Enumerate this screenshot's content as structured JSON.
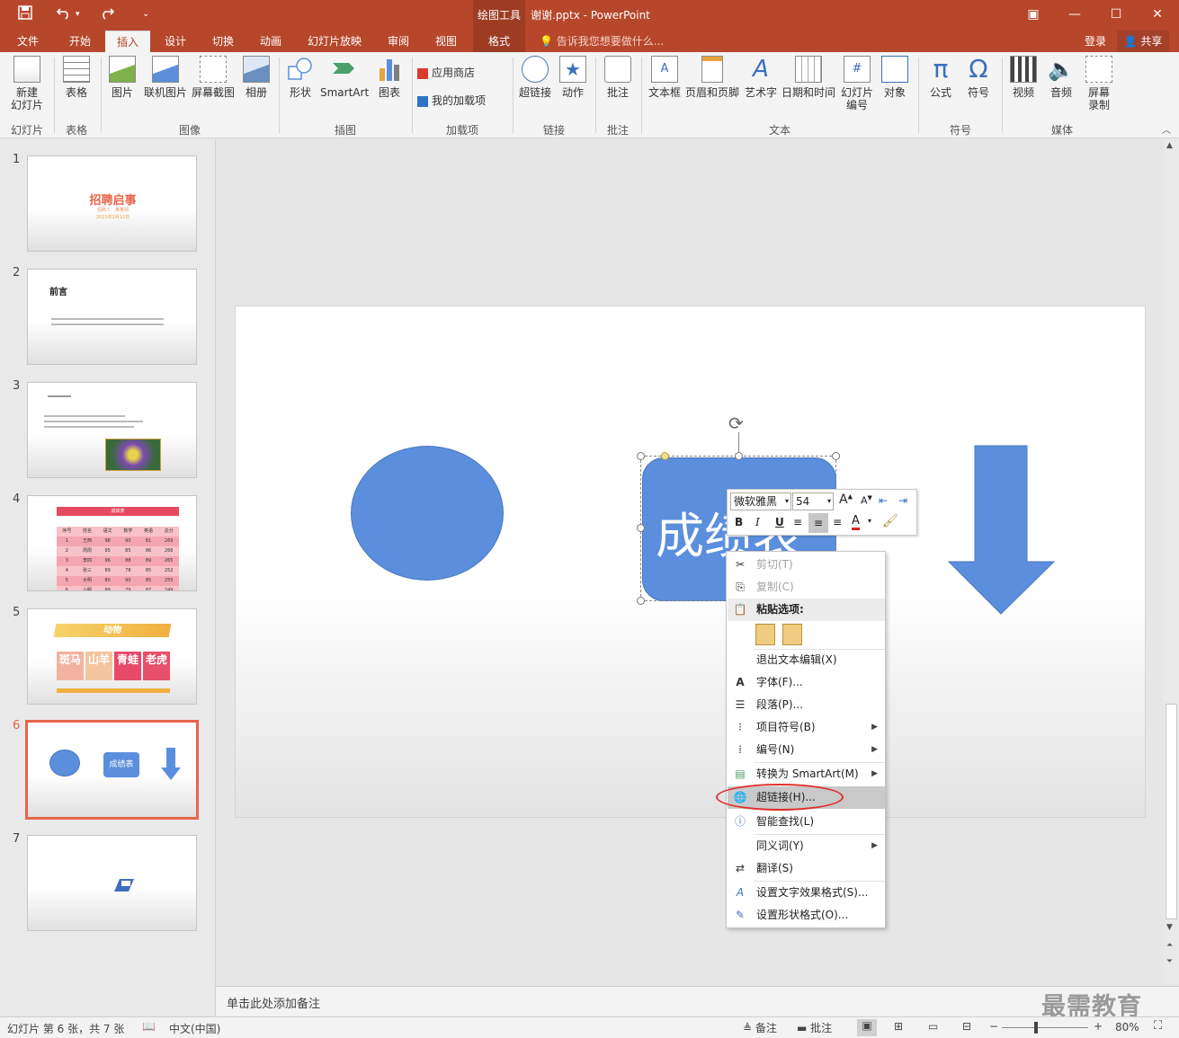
{
  "window": {
    "title": "谢谢.pptx - PowerPoint",
    "context_tab": "绘图工具",
    "controls": {
      "ribbon_display": "▣",
      "minimize": "—",
      "maximize": "☐",
      "close": "✕"
    }
  },
  "qat": {
    "save": "save-icon",
    "undo": "undo-icon",
    "redo": "redo-icon"
  },
  "tabs": [
    "文件",
    "开始",
    "插入",
    "设计",
    "切换",
    "动画",
    "幻灯片放映",
    "审阅",
    "视图",
    "格式"
  ],
  "active_tab": "插入",
  "tellme": "告诉我您想要做什么...",
  "account": {
    "login": "登录",
    "share": "共享"
  },
  "ribbon": {
    "buttons": {
      "new_slide": "新建\n幻灯片",
      "table": "表格",
      "picture": "图片",
      "online_picture": "联机图片",
      "screenshot": "屏幕截图",
      "album": "相册",
      "shapes": "形状",
      "smartart": "SmartArt",
      "chart": "图表",
      "store": "应用商店",
      "my_addins": "我的加载项",
      "hyperlink": "超链接",
      "action": "动作",
      "comment": "批注",
      "textbox": "文本框",
      "header_footer": "页眉和页脚",
      "wordart": "艺术字",
      "datetime": "日期和时间",
      "slide_number": "幻灯片\n编号",
      "object": "对象",
      "equation": "公式",
      "symbol": "符号",
      "video": "视频",
      "audio": "音频",
      "screen_record": "屏幕\n录制"
    },
    "groups": {
      "slides": "幻灯片",
      "tables": "表格",
      "images": "图像",
      "illustrations": "插图",
      "addins": "加载项",
      "links": "链接",
      "comments": "批注",
      "text": "文本",
      "symbols": "符号",
      "media": "媒体"
    }
  },
  "thumbnails": {
    "numbers": [
      "1",
      "2",
      "3",
      "4",
      "5",
      "6",
      "7"
    ],
    "s1_title": "招聘启事",
    "s1_sub": "招聘人：某某网",
    "s1_date": "2021年1月12日",
    "s2_title": "前言",
    "s4_title": "成绩表",
    "s4_headers": [
      "序号",
      "姓名",
      "语文",
      "数学",
      "英语",
      "总分"
    ],
    "s4_rows": [
      [
        "1",
        "王西",
        "98",
        "90",
        "81",
        "269"
      ],
      [
        "2",
        "周周",
        "95",
        "85",
        "86",
        "266"
      ],
      [
        "3",
        "李四",
        "96",
        "88",
        "89",
        "265"
      ],
      [
        "4",
        "张三",
        "89",
        "78",
        "85",
        "252"
      ],
      [
        "5",
        "大明",
        "80",
        "90",
        "85",
        "255"
      ],
      [
        "6",
        "小明",
        "89",
        "79",
        "87",
        "249"
      ]
    ],
    "s5_title": "动物",
    "s5_cells": [
      "斑马",
      "山羊",
      "青蛙",
      "老虎"
    ],
    "s6_label": "成绩表"
  },
  "slide": {
    "shape_text": "成绩表"
  },
  "minitoolbar": {
    "font": "微软雅黑",
    "size": "54",
    "bold": "B",
    "italic": "I",
    "underline": "U",
    "color_letter": "A",
    "grow": "A",
    "shrink": "A"
  },
  "context_menu": {
    "cut": "剪切(T)",
    "copy": "复制(C)",
    "paste_options": "粘贴选项:",
    "exit_edit": "退出文本编辑(X)",
    "font": "字体(F)...",
    "paragraph": "段落(P)...",
    "bullets": "项目符号(B)",
    "numbering": "编号(N)",
    "smartart": "转换为 SmartArt(M)",
    "hyperlink": "超链接(H)...",
    "smart_lookup": "智能查找(L)",
    "synonyms": "同义词(Y)",
    "translate": "翻译(S)",
    "text_effects": "设置文字效果格式(S)...",
    "shape_format": "设置形状格式(O)..."
  },
  "notes": "单击此处添加备注",
  "status": {
    "slide_info": "幻灯片 第 6 张，共 7 张",
    "language": "中文(中国)",
    "notes": "备注",
    "comments": "批注",
    "zoom": "80%"
  },
  "watermark": "最需教育",
  "colors": {
    "accent": "#b7472a",
    "shape": "#5b8fde",
    "highlight_circle": "#e03030"
  }
}
